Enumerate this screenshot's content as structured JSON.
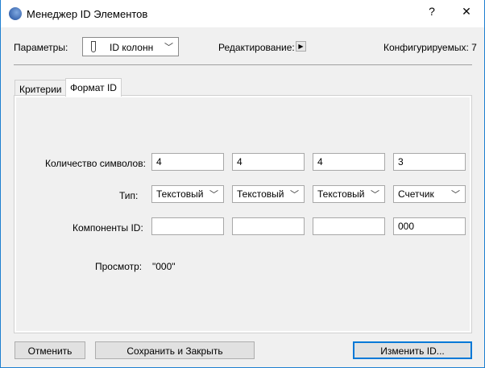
{
  "window": {
    "title": "Менеджер ID Элементов",
    "help": "?",
    "close": "✕"
  },
  "header": {
    "params_label": "Параметры:",
    "params_value": "ID колонн",
    "edit_label": "Редактирование:",
    "configurable": "Конфигурируемых: 7"
  },
  "tabs": [
    {
      "label": "Критерии"
    },
    {
      "label": "Формат ID"
    }
  ],
  "form": {
    "chars_label": "Количество символов:",
    "chars": [
      "4",
      "4",
      "4",
      "3"
    ],
    "type_label": "Тип:",
    "types": [
      "Текстовый",
      "Текстовый",
      "Текстовый",
      "Счетчик"
    ],
    "components_label": "Компоненты ID:",
    "components": [
      "",
      "",
      "",
      "000"
    ],
    "preview_label": "Просмотр:",
    "preview_value": "\"000\""
  },
  "buttons": {
    "cancel": "Отменить",
    "save_close": "Сохранить и Закрыть",
    "change_id": "Изменить ID..."
  }
}
